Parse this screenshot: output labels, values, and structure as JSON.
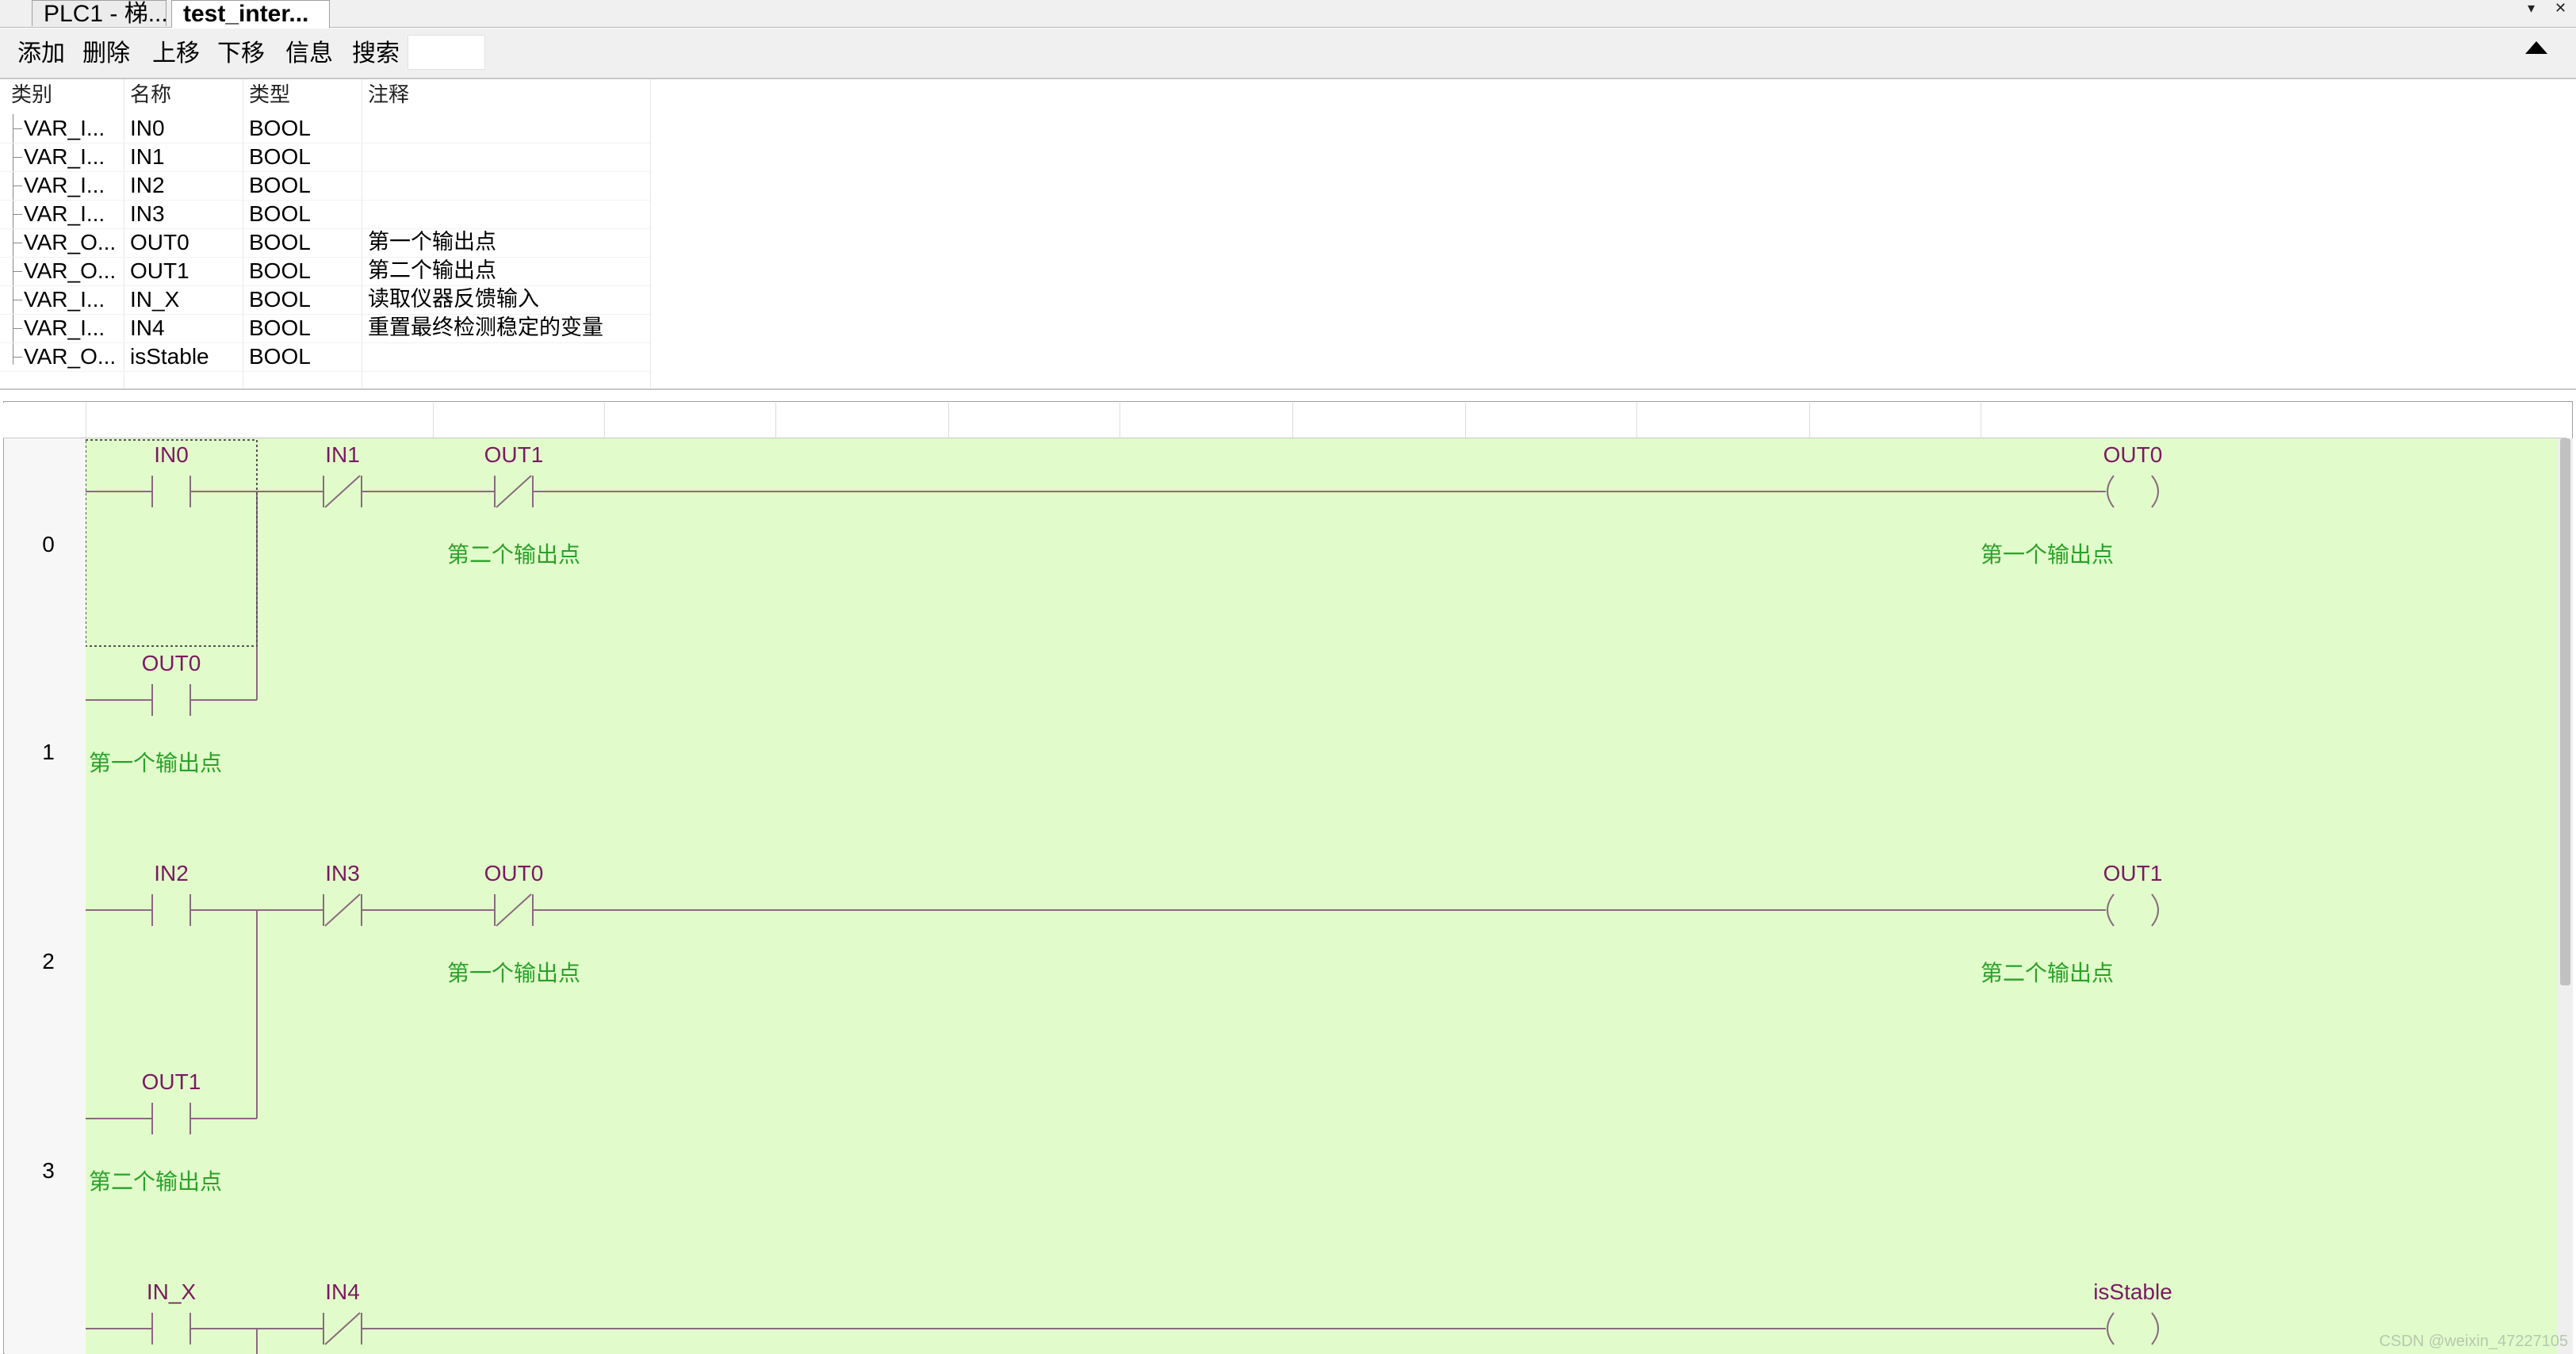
{
  "tabs": [
    {
      "label": "PLC1 - 梯..."
    },
    {
      "label": "test_inter..."
    }
  ],
  "tab_controls": {
    "dropdown_icon": "chevron-down-icon",
    "close_icon": "close-icon"
  },
  "toolbar": {
    "add": "添加",
    "delete": "删除",
    "move_up": "上移",
    "move_down": "下移",
    "info": "信息",
    "search": "搜索",
    "search_value": ""
  },
  "var_table": {
    "headers": {
      "category": "类别",
      "name": "名称",
      "type": "类型",
      "comment": "注释"
    },
    "rows": [
      {
        "category": "VAR_I...",
        "name": "IN0",
        "type": "BOOL",
        "comment": ""
      },
      {
        "category": "VAR_I...",
        "name": "IN1",
        "type": "BOOL",
        "comment": ""
      },
      {
        "category": "VAR_I...",
        "name": "IN2",
        "type": "BOOL",
        "comment": ""
      },
      {
        "category": "VAR_I...",
        "name": "IN3",
        "type": "BOOL",
        "comment": ""
      },
      {
        "category": "VAR_O...",
        "name": "OUT0",
        "type": "BOOL",
        "comment": "第一个输出点"
      },
      {
        "category": "VAR_O...",
        "name": "OUT1",
        "type": "BOOL",
        "comment": "第二个输出点"
      },
      {
        "category": "VAR_I...",
        "name": "IN_X",
        "type": "BOOL",
        "comment": "读取仪器反馈输入"
      },
      {
        "category": "VAR_I...",
        "name": "IN4",
        "type": "BOOL",
        "comment": "重置最终检测稳定的变量"
      },
      {
        "category": "VAR_O...",
        "name": "isStable",
        "type": "BOOL",
        "comment": ""
      }
    ]
  },
  "ladder": {
    "row_numbers": [
      "0",
      "1",
      "2",
      "3"
    ],
    "rungs": [
      {
        "contacts": [
          {
            "label": "IN0",
            "kind": "NO"
          },
          {
            "label": "IN1",
            "kind": "NC"
          },
          {
            "label": "OUT1",
            "kind": "NC",
            "comment": "第二个输出点"
          }
        ],
        "parallel": {
          "label": "OUT0",
          "kind": "NO",
          "comment": "第一个输出点"
        },
        "coil": {
          "label": "OUT0",
          "comment": "第一个输出点"
        }
      },
      {
        "contacts": [
          {
            "label": "IN2",
            "kind": "NO"
          },
          {
            "label": "IN3",
            "kind": "NC"
          },
          {
            "label": "OUT0",
            "kind": "NC",
            "comment": "第一个输出点"
          }
        ],
        "parallel": {
          "label": "OUT1",
          "kind": "NO",
          "comment": "第二个输出点"
        },
        "coil": {
          "label": "OUT1",
          "comment": "第二个输出点"
        }
      },
      {
        "contacts": [
          {
            "label": "IN_X",
            "kind": "NO"
          },
          {
            "label": "IN4",
            "kind": "NC"
          }
        ],
        "coil": {
          "label": "isStable"
        }
      }
    ],
    "colors": {
      "background": "#e1fcca",
      "wire": "#8a6a80",
      "label": "#7a1a62",
      "comment": "#2aa12a",
      "selection": "#555555"
    }
  },
  "watermark": "CSDN @weixin_47227105"
}
